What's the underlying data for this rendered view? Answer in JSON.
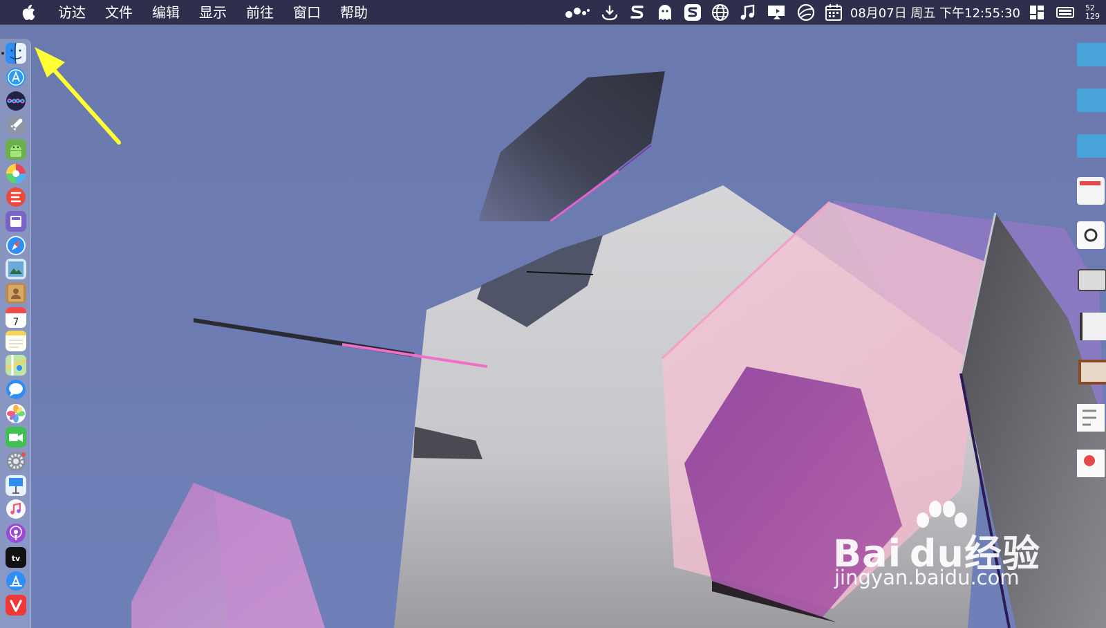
{
  "menubar": {
    "background": "#2e2f4c",
    "apple_icon": "apple-logo-icon",
    "menus": [
      "访达",
      "文件",
      "编辑",
      "显示",
      "前往",
      "窗口",
      "帮助"
    ],
    "status_icons": [
      "dots-app-icon",
      "download-icon",
      "sogou-s-icon",
      "ghost-icon",
      "sogou-input-icon",
      "globe-icon",
      "music-note-icon",
      "display-icon",
      "network-globe-icon",
      "calendar-icon"
    ],
    "datetime": "08月07日 周五 下午12:55:30",
    "trailing_icons": [
      "window-grid-icon",
      "battery-icon"
    ],
    "speed_up": "52",
    "speed_down": "129"
  },
  "dock": {
    "apps": [
      {
        "name": "finder-icon",
        "running": true
      },
      {
        "name": "app-store-compass-icon"
      },
      {
        "name": "siri-icon"
      },
      {
        "name": "launchpad-rocket-icon"
      },
      {
        "name": "android-icon"
      },
      {
        "name": "color-wheel-icon"
      },
      {
        "name": "red-app-icon"
      },
      {
        "name": "purple-app-icon"
      },
      {
        "name": "safari-icon"
      },
      {
        "name": "preview-icon"
      },
      {
        "name": "contacts-book-icon"
      },
      {
        "name": "calendar-icon",
        "label": "7"
      },
      {
        "name": "notes-icon"
      },
      {
        "name": "maps-icon"
      },
      {
        "name": "messages-icon"
      },
      {
        "name": "photos-icon"
      },
      {
        "name": "facetime-icon"
      },
      {
        "name": "system-preferences-icon"
      },
      {
        "name": "keynote-icon"
      },
      {
        "name": "itunes-icon"
      },
      {
        "name": "podcasts-icon"
      },
      {
        "name": "apple-tv-icon",
        "label": "tv"
      },
      {
        "name": "app-store-icon"
      },
      {
        "name": "vivaldi-icon"
      }
    ]
  },
  "annotation": {
    "arrow_color": "#ffff33"
  },
  "watermark": {
    "brand": "Bai du经验",
    "site": "jingyan.baidu.com"
  },
  "wallpaper": {
    "background": "#6b7bb0"
  }
}
